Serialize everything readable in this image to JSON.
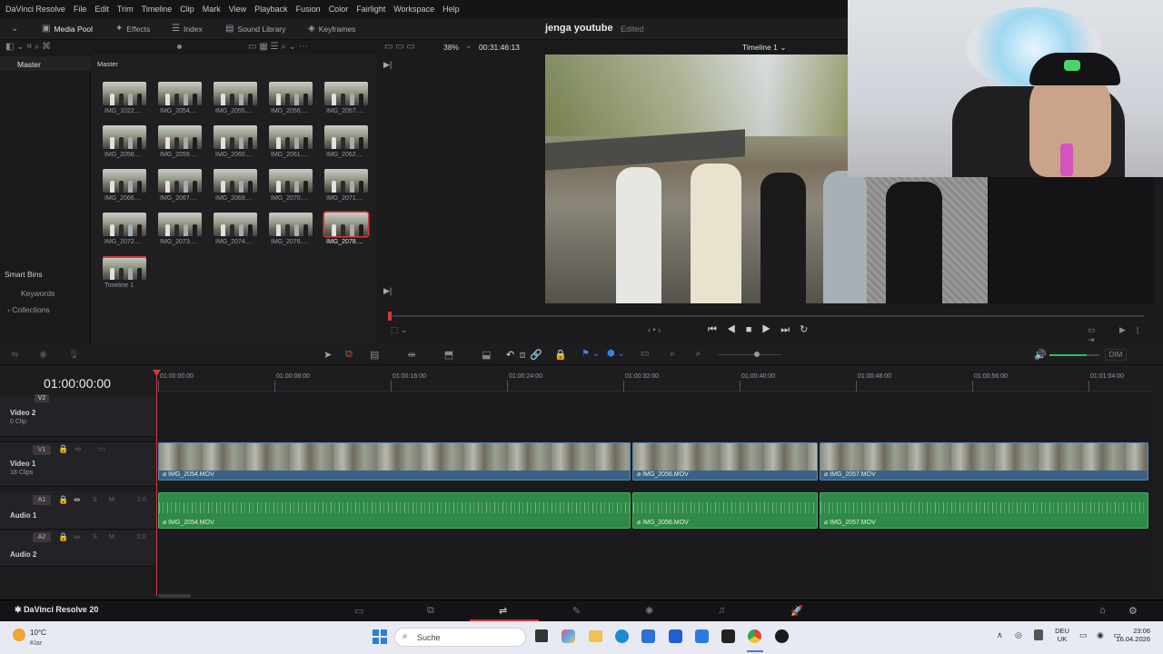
{
  "menu": [
    "DaVinci Resolve",
    "File",
    "Edit",
    "Trim",
    "Timeline",
    "Clip",
    "Mark",
    "View",
    "Playback",
    "Fusion",
    "Color",
    "Fairlight",
    "Workspace",
    "Help"
  ],
  "toolbar": {
    "media_pool": "Media Pool",
    "effects": "Effects",
    "index": "Index",
    "sound_library": "Sound Library",
    "keyframes": "Keyframes",
    "project_title": "jenga youtube",
    "project_status": "Edited",
    "zoom": "38%",
    "timecode": "00:31:46:13",
    "timeline_name": "Timeline 1"
  },
  "bins": {
    "master": "Master",
    "pool_title": "Master",
    "smart_bins": "Smart Bins",
    "keywords": "Keywords",
    "collections": "Collections"
  },
  "clips": [
    "IMG_1022....",
    "IMG_2054....",
    "IMG_2055....",
    "IMG_2056....",
    "IMG_2057....",
    "IMG_2058....",
    "IMG_2059....",
    "IMG_2060....",
    "IMG_2061....",
    "IMG_2062....",
    "IMG_2066....",
    "IMG_2067....",
    "IMG_2069....",
    "IMG_2070....",
    "IMG_2071....",
    "IMG_2072....",
    "IMG_2073....",
    "IMG_2074....",
    "IMG_2076....",
    "IMG_2078....",
    "Timeline 1"
  ],
  "timeline": {
    "current_tc": "01:00:00:00",
    "ruler": [
      "01:00:00:00",
      "01:00:08:00",
      "01:00:16:00",
      "01:00:24:00",
      "01:00:32:00",
      "01:00:40:00",
      "01:00:48:00",
      "01:00:56:00",
      "01:01:04:00"
    ],
    "tracks": {
      "v2_tag": "V2",
      "video2": "Video 2",
      "video2_sub": "0 Clip",
      "v1_tag": "V1",
      "video1": "Video 1",
      "video1_sub": "18 Clips",
      "a1_tag": "A1",
      "audio1": "Audio 1",
      "a2_tag": "A2",
      "audio2": "Audio 2",
      "channels": "2.0",
      "s": "S",
      "m": "M"
    },
    "clip_names": [
      "IMG_2054.MOV",
      "IMG_2056.MOV",
      "IMG_2057.MOV"
    ],
    "dim": "DIM",
    "volume_level": 0.75
  },
  "bottom": {
    "app_name": "DaVinci Resolve 20"
  },
  "taskbar": {
    "weather_temp": "10°C",
    "weather_desc": "Klar",
    "search_placeholder": "Suche",
    "lang_top": "DEU",
    "lang_bottom": "UK",
    "time": "23:06",
    "date": "16.04.2026"
  }
}
